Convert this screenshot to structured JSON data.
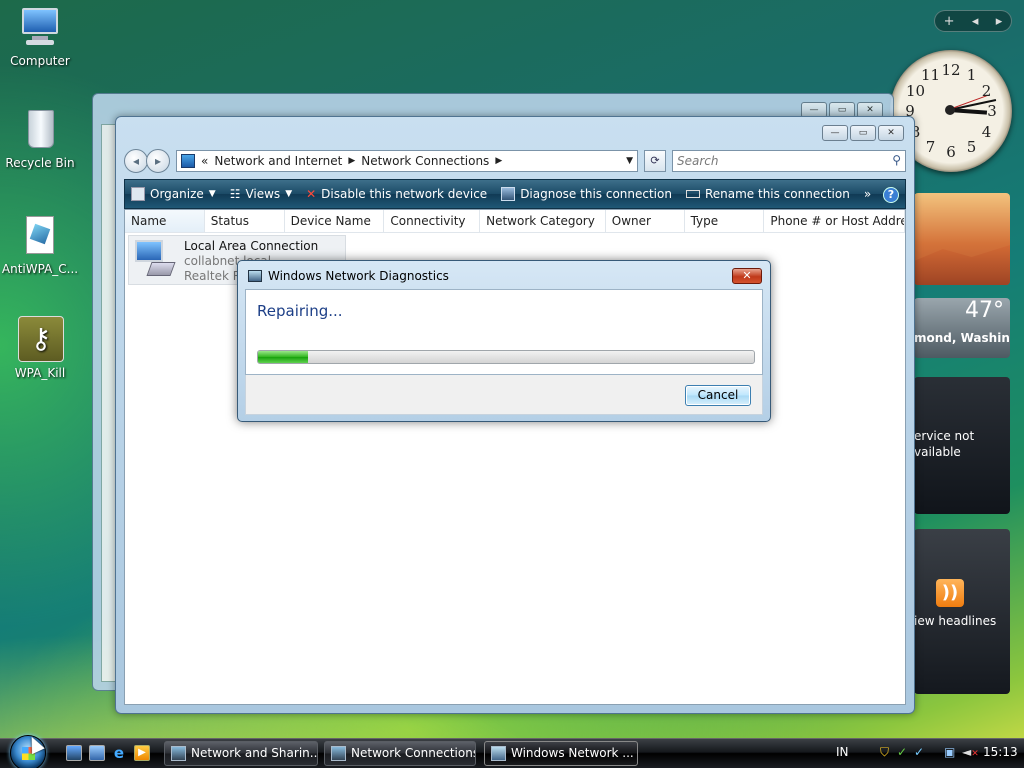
{
  "desktop": {
    "icons": [
      {
        "label": "Computer",
        "icon": "computer-icon"
      },
      {
        "label": "Recycle Bin",
        "icon": "recycle-bin-icon"
      },
      {
        "label": "AntiWPA_C...",
        "icon": "document-icon"
      },
      {
        "label": "WPA_Kill",
        "icon": "key-icon"
      }
    ]
  },
  "sidebar": {
    "weather": {
      "temp": "47°",
      "location": "mond, Washing..."
    },
    "feed_status": "ervice not\nvailable",
    "headlines": "iew headlines",
    "clock_numbers": [
      "12",
      "1",
      "2",
      "3",
      "4",
      "5",
      "6",
      "7",
      "8",
      "9",
      "10",
      "11"
    ]
  },
  "explorer": {
    "breadcrumb": [
      "Network and Internet",
      "Network Connections"
    ],
    "search_placeholder": "Search",
    "commands": [
      "Organize",
      "Views",
      "Disable this network device",
      "Diagnose this connection",
      "Rename this connection"
    ],
    "more": "»",
    "columns": [
      "Name",
      "Status",
      "Device Name",
      "Connectivity",
      "Network Category",
      "Owner",
      "Type",
      "Phone # or Host Addre..."
    ],
    "items": [
      {
        "name": "Local Area Connection",
        "line2": "collabnet.local",
        "line3": "Realtek RT"
      }
    ]
  },
  "dialog": {
    "title": "Windows Network Diagnostics",
    "heading": "Repairing...",
    "progress": 0.1,
    "cancel_label": "Cancel"
  },
  "taskbar": {
    "buttons": [
      {
        "label": "Network and Sharin..."
      },
      {
        "label": "Network Connections"
      },
      {
        "label": "Windows Network ..."
      }
    ],
    "language": "IN",
    "time": "15:13"
  },
  "colors": {
    "accent": "#1d3f87",
    "command_bar": "#1b4a66",
    "progress": "#2fb51e",
    "close_button": "#c0391b"
  }
}
